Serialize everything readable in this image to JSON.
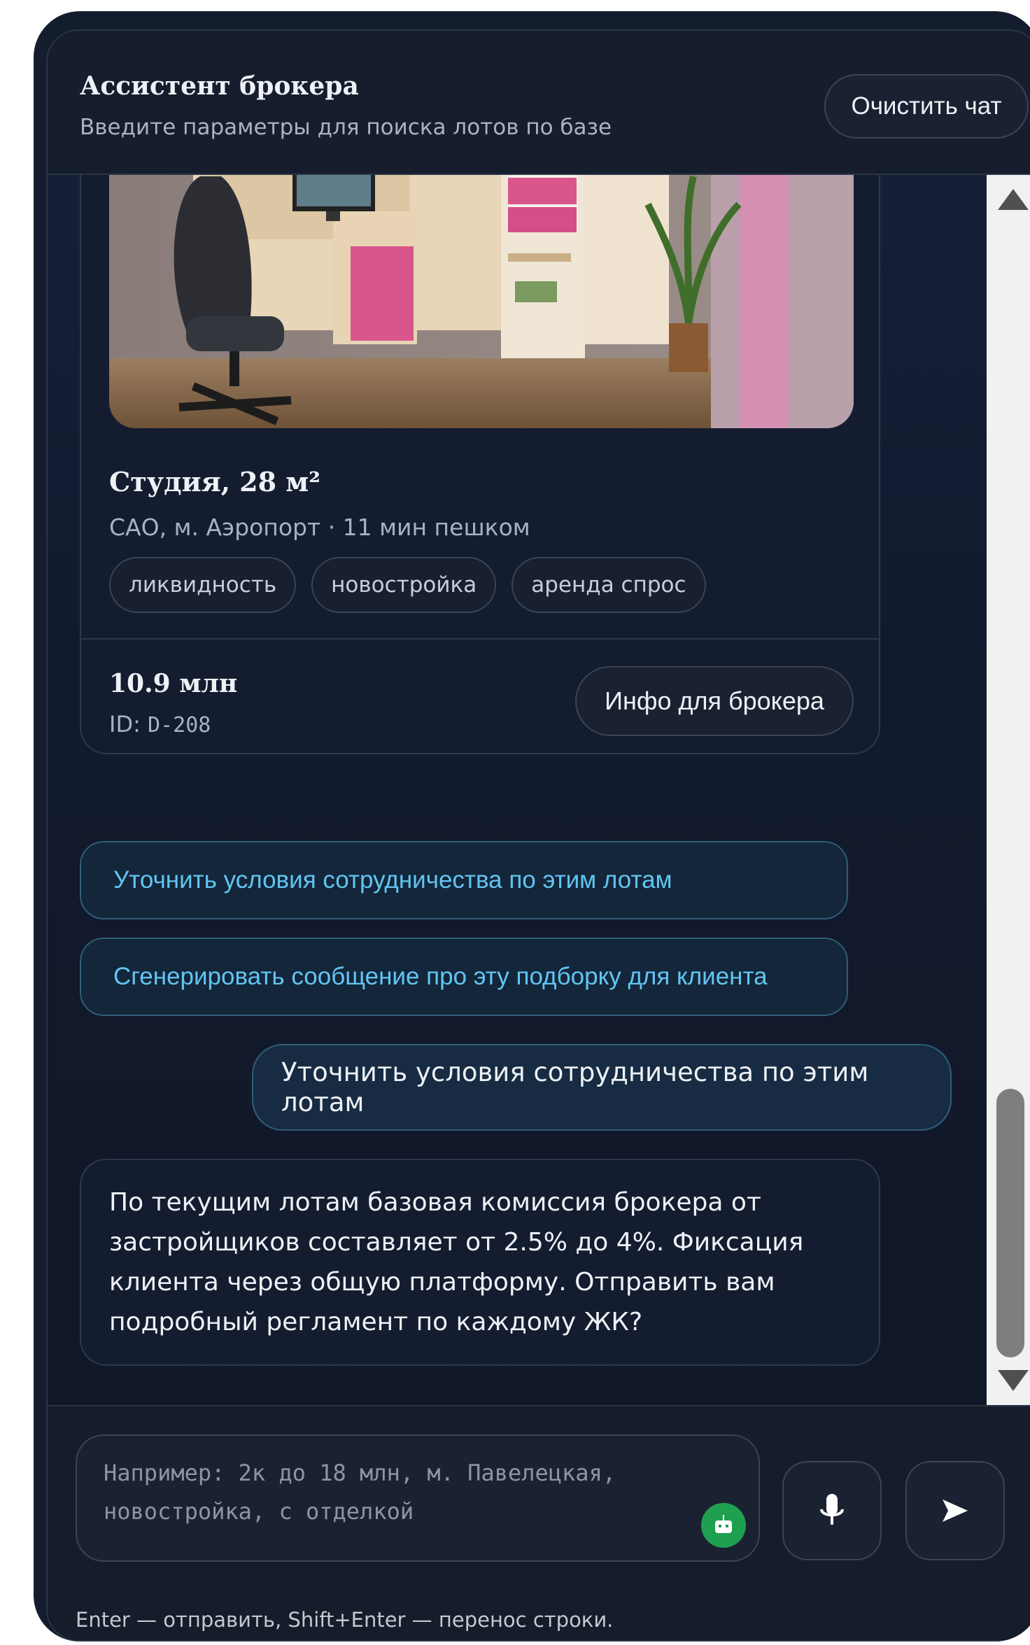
{
  "header": {
    "title": "Ассистент брокера",
    "subtitle": "Введите параметры для поиска лотов по базе",
    "clear_label": "Очистить чат"
  },
  "lot": {
    "title": "Студия, 28 м²",
    "location": "САО, м. Аэропорт · 11 мин пешком",
    "tags": [
      "ликвидность",
      "новостройка",
      "аренда спрос"
    ],
    "price": "10.9 млн",
    "id_prefix": "ID:",
    "id_value": "D-208",
    "info_label": "Инфо для брокера"
  },
  "suggestions": [
    "Уточнить условия сотрудничества по этим лотам",
    "Сгенерировать сообщение про эту подборку для клиента"
  ],
  "messages": {
    "user": "Уточнить условия сотрудничества по этим лотам",
    "bot": "По текущим лотам базовая комиссия брокера от застройщиков составляет от 2.5% до 4%. Фиксация клиента через общую платформу. Отправить вам подробный регламент по каждому ЖК?"
  },
  "composer": {
    "placeholder": "Например: 2к до 18 млн, м. Павелецкая, новостройка, с отделкой",
    "hint": "Enter — отправить, Shift+Enter — перенос строки."
  },
  "icons": {
    "assist": "robot-icon",
    "mic": "microphone-icon",
    "send": "send-icon"
  },
  "colors": {
    "accent": "#62c5f2",
    "assist_badge": "#1fa050"
  }
}
